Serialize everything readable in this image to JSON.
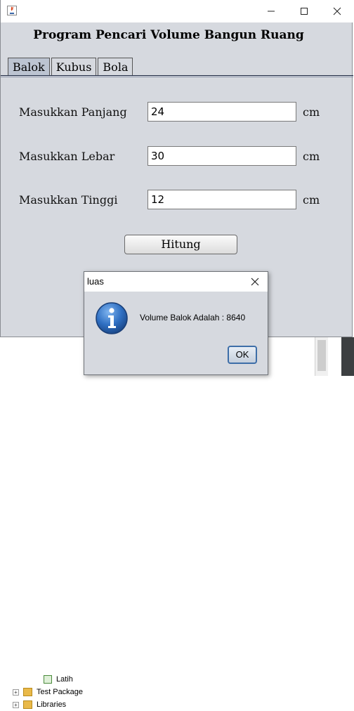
{
  "window": {
    "heading": "Program Pencari Volume Bangun Ruang",
    "controls": {
      "minimize": "minimize-icon",
      "maximize": "maximize-icon",
      "close": "close-icon"
    }
  },
  "tabs": [
    {
      "label": "Balok",
      "active": true
    },
    {
      "label": "Kubus",
      "active": false
    },
    {
      "label": "Bola",
      "active": false
    }
  ],
  "form": {
    "panjang": {
      "label": "Masukkan Panjang",
      "value": "24",
      "unit": "cm"
    },
    "lebar": {
      "label": "Masukkan Lebar",
      "value": "30",
      "unit": "cm"
    },
    "tinggi": {
      "label": "Masukkan Tinggi",
      "value": "12",
      "unit": "cm"
    },
    "button_label": "Hitung"
  },
  "dialog": {
    "title": "luas",
    "message": "Volume Balok Adalah : 8640",
    "ok_label": "OK",
    "icon": "info-icon"
  },
  "background_tree": {
    "items": [
      {
        "label": "Latih"
      },
      {
        "label": "Test Package"
      },
      {
        "label": "Libraries"
      }
    ]
  },
  "colors": {
    "window_bg": "#d6d9df",
    "tab_active_bg": "#bcc4d1",
    "info_icon": "#2f6fc2"
  }
}
